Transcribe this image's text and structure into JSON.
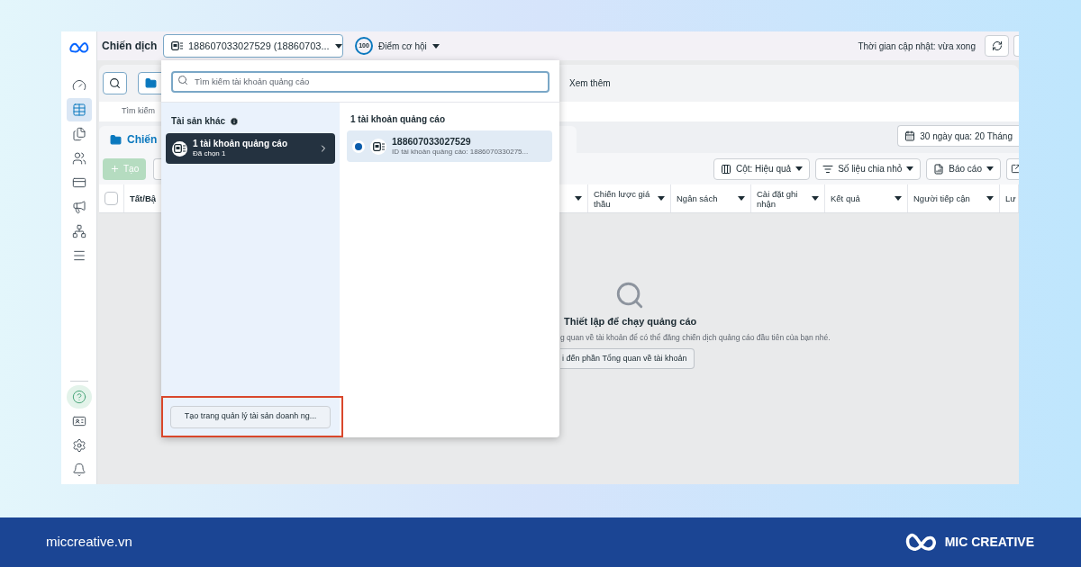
{
  "top_bar": {
    "title": "Chiến dịch",
    "account_select": "188607033027529 (18860703...",
    "score": "100",
    "score_label": "Điểm cơ hội",
    "update_time": "Thời gian cập nhật: vừa xong"
  },
  "sidebar": {
    "items": [
      {
        "kind": "gauge",
        "selected": false
      },
      {
        "kind": "table",
        "selected": true
      },
      {
        "kind": "pages",
        "selected": false
      },
      {
        "kind": "people",
        "selected": false
      },
      {
        "kind": "card",
        "selected": false
      },
      {
        "kind": "megaphone",
        "selected": false
      },
      {
        "kind": "network",
        "selected": false
      },
      {
        "kind": "menu",
        "selected": false
      }
    ],
    "bottom_items": [
      {
        "kind": "help",
        "selected": false
      },
      {
        "kind": "idcard",
        "selected": false
      },
      {
        "kind": "settings",
        "selected": false
      },
      {
        "kind": "bell",
        "selected": false
      }
    ]
  },
  "toolbar": {
    "more": "Xem thêm",
    "search_placeholder": "Tìm kiếm"
  },
  "tabs": [
    {
      "label": "Chiến",
      "selected": true
    }
  ],
  "date_range": "30 ngày qua: 20 Tháng",
  "actions": {
    "create": {
      "label": "Tạo",
      "disabled": true
    },
    "buttons": [
      {
        "kind": "columns",
        "label": "Cột: Hiệu quả"
      },
      {
        "kind": "breakdown",
        "label": "Số liệu chia nhỏ"
      },
      {
        "kind": "report",
        "label": "Báo cáo"
      }
    ]
  },
  "table": {
    "select_all_checked": false,
    "columns": [
      "Tất/Bậ",
      "Chiến lược giá thầu",
      "Ngân sách",
      "Cài đặt ghi nhận",
      "Kết quả",
      "Người tiếp cận",
      "Lư"
    ]
  },
  "empty_state": {
    "title": "Thiết lập để chạy quảng cáo",
    "text": "g quan về tài khoản để có thể đăng chiến dịch quảng cáo đầu tiên của bạn nhé.",
    "button": "i đến phần Tổng quan về tài khoản"
  },
  "account_dropdown": {
    "search_placeholder": "Tìm kiếm tài khoản quảng cáo",
    "assets_title": "Tài sản khác",
    "asset_items": [
      {
        "title": "1 tài khoản quảng cáo",
        "subtitle": "Đã chọn 1",
        "selected": true
      }
    ],
    "accounts_title": "1 tài khoản quảng cáo",
    "accounts": [
      {
        "name": "188607033027529",
        "id_text": "ID tài khoản quảng cáo: 1886070330275...",
        "selected": true
      }
    ],
    "create_button": "Tạo trang quản lý tài sản doanh ng...",
    "create_button_highlighted": true
  },
  "footer": {
    "site": "miccreative.vn",
    "brand": "MIC CREATIVE"
  }
}
